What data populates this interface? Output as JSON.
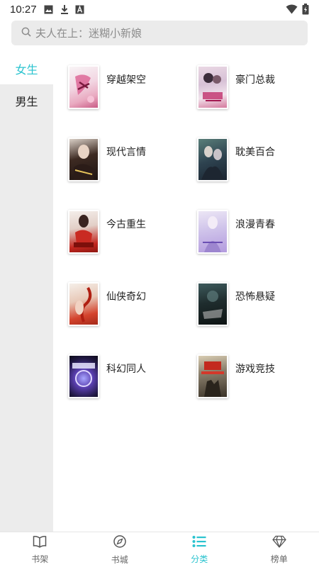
{
  "status_bar": {
    "time": "10:27",
    "icons": [
      "image-icon",
      "download-icon",
      "font-icon",
      "wifi-icon",
      "battery-icon"
    ]
  },
  "search": {
    "placeholder": "夫人在上：迷糊小新娘"
  },
  "gender_tabs": [
    {
      "label": "女生",
      "active": true
    },
    {
      "label": "男生",
      "active": false
    }
  ],
  "genres": [
    {
      "label": "穿越架空"
    },
    {
      "label": "豪门总裁"
    },
    {
      "label": "现代言情"
    },
    {
      "label": "耽美百合"
    },
    {
      "label": "今古重生"
    },
    {
      "label": "浪漫青春"
    },
    {
      "label": "仙侠奇幻"
    },
    {
      "label": "恐怖悬疑"
    },
    {
      "label": "科幻同人"
    },
    {
      "label": "游戏竞技"
    }
  ],
  "bottom_nav": [
    {
      "label": "书架",
      "icon": "book-icon",
      "active": false
    },
    {
      "label": "书城",
      "icon": "compass-icon",
      "active": false
    },
    {
      "label": "分类",
      "icon": "list-icon",
      "active": true
    },
    {
      "label": "榜单",
      "icon": "diamond-icon",
      "active": false
    }
  ],
  "colors": {
    "accent": "#2ac3cf",
    "sidebar_bg": "#ececec",
    "search_bg": "#ebebeb"
  }
}
